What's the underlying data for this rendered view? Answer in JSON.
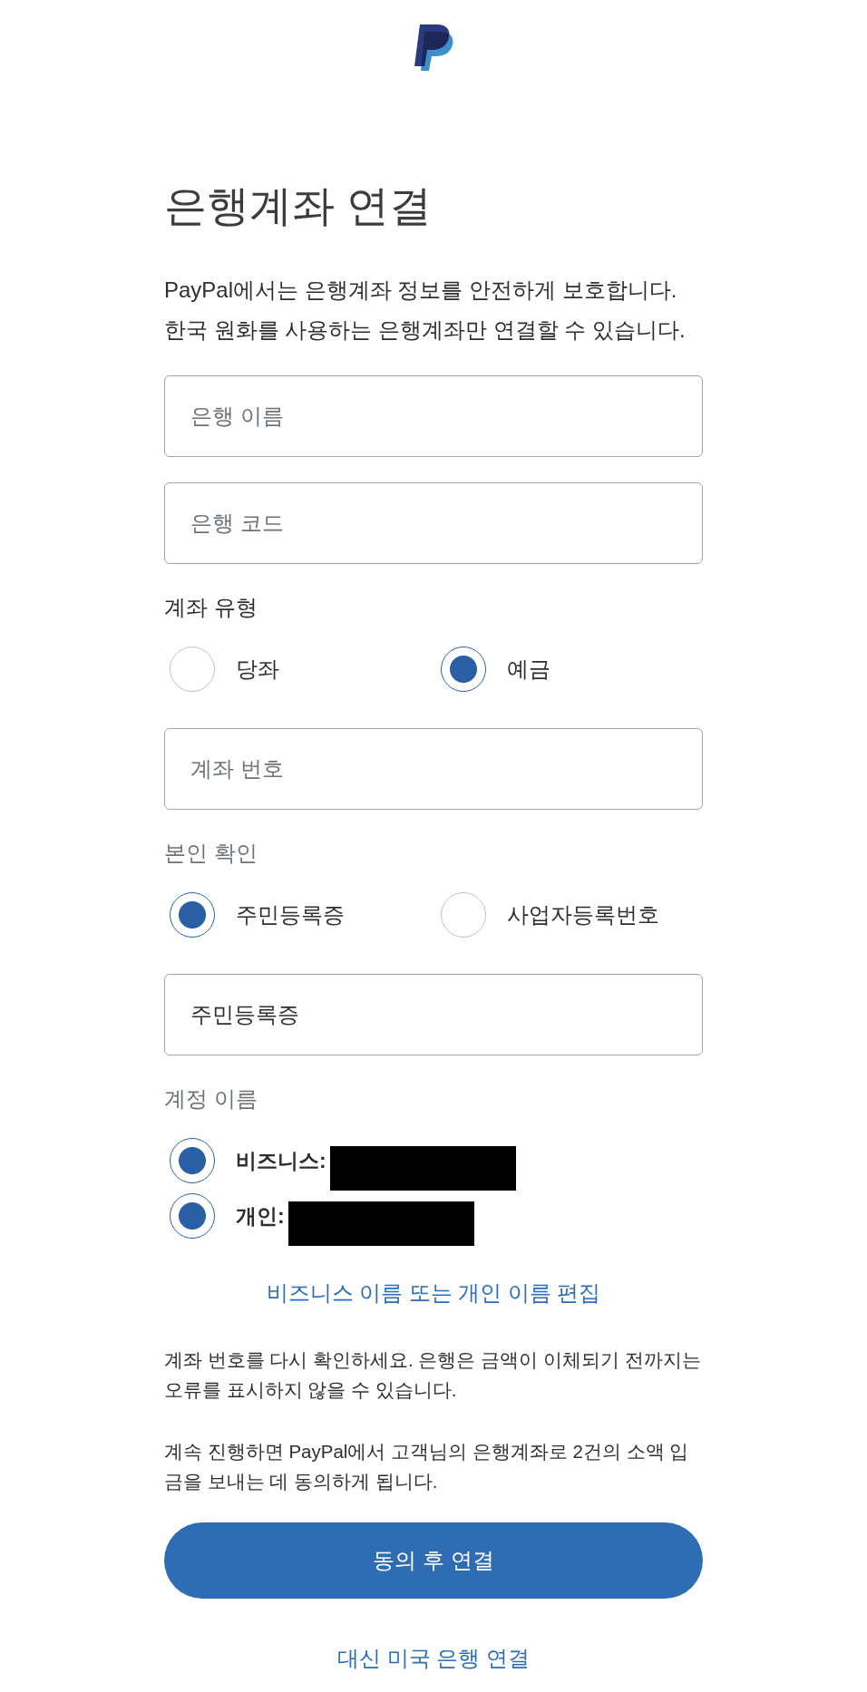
{
  "title": "은행계좌 연결",
  "intro": "PayPal에서는 은행계좌 정보를 안전하게 보호합니다. 한국 원화를 사용하는 은행계좌만 연결할 수 있습니다.",
  "form": [
    {
      "kind": "field",
      "placeholder": "은행 이름"
    },
    {
      "kind": "field",
      "placeholder": "은행 코드"
    },
    {
      "kind": "radio_group",
      "label": "계좌 유형",
      "muted": false,
      "options": [
        {
          "label": "당좌",
          "selected": false
        },
        {
          "label": "예금",
          "selected": true
        }
      ]
    },
    {
      "kind": "field",
      "placeholder": "계좌 번호"
    },
    {
      "kind": "radio_group",
      "label": "본인 확인",
      "muted": true,
      "options": [
        {
          "label": "주민등록증",
          "selected": true
        },
        {
          "label": "사업자등록번호",
          "selected": false
        }
      ]
    },
    {
      "kind": "field",
      "value": "주민등록증"
    },
    {
      "kind": "check_group",
      "label": "계정 이름",
      "muted": true,
      "options": [
        {
          "label": "비즈니스:",
          "checked": true,
          "redacted": true
        },
        {
          "label": "개인:",
          "checked": true,
          "redacted": true
        }
      ]
    }
  ],
  "edit_link": "비즈니스 이름 또는 개인 이름 편집",
  "notes": [
    "계좌 번호를 다시 확인하세요. 은행은 금액이 이체되기 전까지는 오류를 표시하지 않을 수 있습니다.",
    "계속 진행하면 PayPal에서 고객님의 은행계좌로 2건의 소액 입금을 보내는 데 동의하게 됩니다."
  ],
  "primary_button": "동의 후 연결",
  "secondary_link": "대신 미국 은행 연결"
}
